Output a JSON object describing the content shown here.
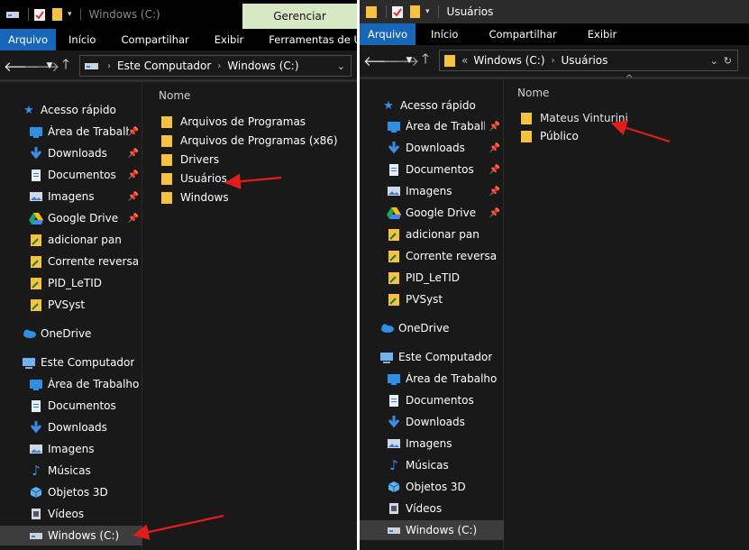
{
  "left": {
    "title": "Windows (C:)",
    "manage_tab": "Gerenciar",
    "ribbon": [
      "Arquivo",
      "Início",
      "Compartilhar",
      "Exibir",
      "Ferramentas de Unida"
    ],
    "breadcrumb": [
      "Este Computador",
      "Windows (C:)"
    ],
    "column_header": "Nome",
    "files": [
      "Arquivos de Programas",
      "Arquivos de Programas (x86)",
      "Drivers",
      "Usuários",
      "Windows"
    ],
    "quick_access": {
      "label": "Acesso rápido",
      "items": [
        "Área de Trabalho",
        "Downloads",
        "Documentos",
        "Imagens",
        "Google Drive",
        "adicionar pan",
        "Corrente reversa",
        "PID_LeTID",
        "PVSyst"
      ]
    },
    "onedrive": "OneDrive",
    "this_pc": {
      "label": "Este Computador",
      "items": [
        "Área de Trabalho",
        "Documentos",
        "Downloads",
        "Imagens",
        "Músicas",
        "Objetos 3D",
        "Vídeos",
        "Windows (C:)"
      ]
    }
  },
  "right": {
    "title": "Usuários",
    "ribbon": [
      "Arquivo",
      "Início",
      "Compartilhar",
      "Exibir"
    ],
    "breadcrumb_prefix": "«",
    "breadcrumb": [
      "Windows (C:)",
      "Usuários"
    ],
    "column_header": "Nome",
    "files": [
      "Mateus Vinturini",
      "Público"
    ],
    "quick_access": {
      "label": "Acesso rápido",
      "items": [
        "Área de Trabalho",
        "Downloads",
        "Documentos",
        "Imagens",
        "Google Drive",
        "adicionar pan",
        "Corrente reversa",
        "PID_LeTID",
        "PVSyst"
      ]
    },
    "onedrive": "OneDrive",
    "this_pc": {
      "label": "Este Computador",
      "items": [
        "Área de Trabalho",
        "Documentos",
        "Downloads",
        "Imagens",
        "Músicas",
        "Objetos 3D",
        "Vídeos",
        "Windows (C:)"
      ]
    }
  },
  "colors": {
    "window_bg": "#191919",
    "ribbon_active": "#1766b8",
    "folder_yellow": "#f5c242",
    "annotation_red": "#e21b1b",
    "manage_tab_bg": "#d6e8c4"
  }
}
